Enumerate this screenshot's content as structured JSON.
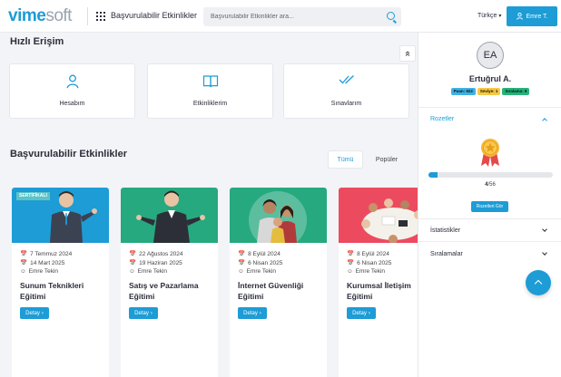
{
  "header": {
    "logo_bold": "vime",
    "logo_light": "soft",
    "page_title": "Başvurulabilir Etkinlikler",
    "search_placeholder": "Başvurulabilir Etkinlikler ara...",
    "language": "Türkçe",
    "user_button": "Emre T."
  },
  "quick_access": {
    "title": "Hızlı Erişim",
    "items": [
      {
        "label": "Hesabım",
        "icon": "person-icon"
      },
      {
        "label": "Etkinliklerim",
        "icon": "book-icon"
      },
      {
        "label": "Sınavlarım",
        "icon": "double-check-icon"
      }
    ]
  },
  "events": {
    "title": "Başvurulabilir Etkinlikler",
    "tabs": [
      "Tümü",
      "Popüler"
    ],
    "cards": [
      {
        "badge": "SERTİFİKALI",
        "start": "7 Temmuz 2024",
        "end": "14 Mart 2025",
        "instructor": "Emre Tekin",
        "title": "Sunum Teknikleri Eğitimi",
        "button": "Detay",
        "color": "#1d9cd6"
      },
      {
        "badge": "",
        "start": "22 Ağustos 2024",
        "end": "19 Haziran 2025",
        "instructor": "Emre Tekin",
        "title": "Satış ve Pazarlama Eğitimi",
        "button": "Detay",
        "color": "#26a97f"
      },
      {
        "badge": "",
        "start": "8 Eylül 2024",
        "end": "6 Nisan 2025",
        "instructor": "Emre Tekin",
        "title": "İnternet Güvenliği Eğitimi",
        "button": "Detay",
        "color": "#26a97f"
      },
      {
        "badge": "",
        "start": "8 Eylül 2024",
        "end": "6 Nisan 2025",
        "instructor": "Emre Tekin",
        "title": "Kurumsal İletişim Eğitimi",
        "button": "Detay",
        "color": "#ec4b5f"
      }
    ]
  },
  "profile": {
    "initials": "EA",
    "name": "Ertuğrul A.",
    "pills": [
      "Puan: 922",
      "Seviye: 1",
      "Sıralama: 8"
    ],
    "badges_title": "Rozetler",
    "progress_current": "4",
    "progress_total": "/56",
    "progress_fraction": 0.07,
    "badges_button": "Rozetleri Gör",
    "stats_title": "İstatistikler",
    "ranks_title": "Sıralamalar"
  },
  "colors": {
    "accent": "#1d9cd6",
    "green": "#26a97f",
    "red": "#ec4b5f"
  }
}
